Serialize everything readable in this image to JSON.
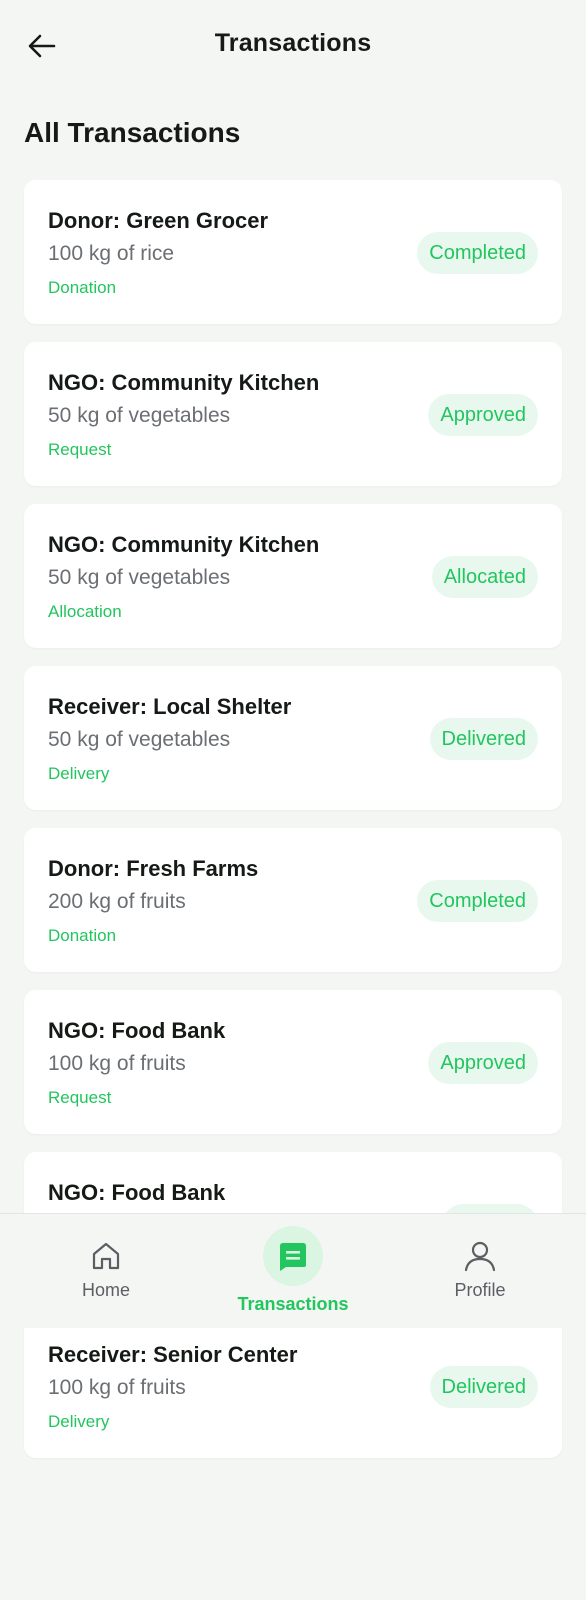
{
  "header": {
    "title": "Transactions",
    "back_icon": "arrow-left-icon"
  },
  "section": {
    "title": "All Transactions"
  },
  "transactions": [
    {
      "name": "Donor: Green Grocer",
      "quantity": "100 kg of rice",
      "type": "Donation",
      "status": "Completed"
    },
    {
      "name": "NGO: Community Kitchen",
      "quantity": "50 kg of vegetables",
      "type": "Request",
      "status": "Approved"
    },
    {
      "name": "NGO: Community Kitchen",
      "quantity": "50 kg of vegetables",
      "type": "Allocation",
      "status": "Allocated"
    },
    {
      "name": "Receiver: Local Shelter",
      "quantity": "50 kg of vegetables",
      "type": "Delivery",
      "status": "Delivered"
    },
    {
      "name": "Donor: Fresh Farms",
      "quantity": "200 kg of fruits",
      "type": "Donation",
      "status": "Completed"
    },
    {
      "name": "NGO: Food Bank",
      "quantity": "100 kg of fruits",
      "type": "Request",
      "status": "Approved"
    },
    {
      "name": "NGO: Food Bank",
      "quantity": "",
      "type": "",
      "status": ""
    },
    {
      "name": "Receiver: Senior Center",
      "quantity": "100 kg of fruits",
      "type": "Delivery",
      "status": "Delivered"
    }
  ],
  "bottom_nav": {
    "items": [
      {
        "label": "Home",
        "icon": "home-icon",
        "active": false
      },
      {
        "label": "Transactions",
        "icon": "receipt-icon",
        "active": true
      },
      {
        "label": "Profile",
        "icon": "person-icon",
        "active": false
      }
    ]
  },
  "colors": {
    "accent": "#22c55e",
    "badge_bg": "#e8f8ee",
    "background": "#f4f6f4",
    "card": "#ffffff",
    "text": "#151a16",
    "muted": "#6b6f73"
  }
}
